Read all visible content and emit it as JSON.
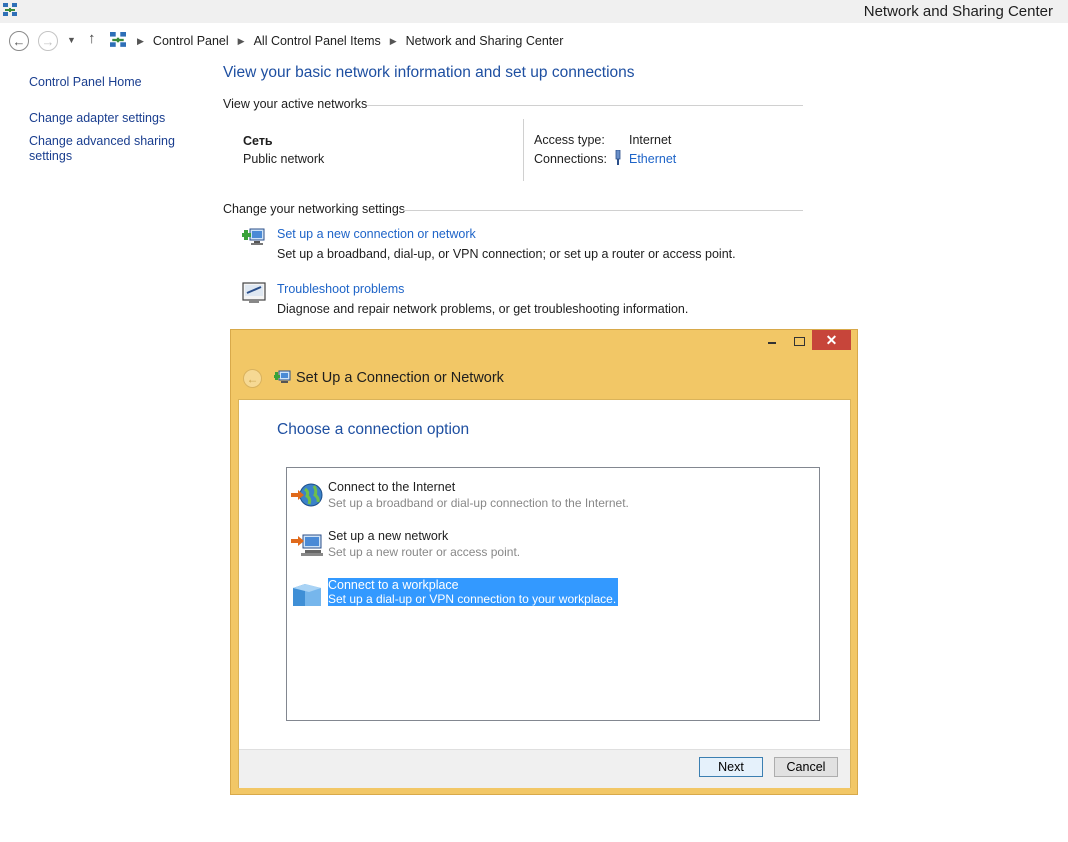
{
  "window": {
    "title": "Network and Sharing Center"
  },
  "address_bar": {
    "crumbs": [
      "Control Panel",
      "All Control Panel Items",
      "Network and Sharing Center"
    ]
  },
  "left_nav": {
    "home": "Control Panel Home",
    "adapter": "Change adapter settings",
    "sharing_line1": "Change advanced sharing",
    "sharing_line2": "settings"
  },
  "main": {
    "heading": "View your basic network information and set up connections",
    "active_networks_label": "View your active networks",
    "network_name": "Сеть",
    "network_type": "Public network",
    "access_type_label": "Access type:",
    "access_type_value": "Internet",
    "connections_label": "Connections:",
    "connections_value": "Ethernet",
    "change_settings_label": "Change your networking settings",
    "setup_link": "Set up a new connection or network",
    "setup_desc": "Set up a broadband, dial-up, or VPN connection; or set up a router or access point.",
    "troubleshoot_link": "Troubleshoot problems",
    "troubleshoot_desc": "Diagnose and repair network problems, or get troubleshooting information."
  },
  "dialog": {
    "title": "Set Up a Connection or Network",
    "heading": "Choose a connection option",
    "options": [
      {
        "title": "Connect to the Internet",
        "subtitle": "Set up a broadband or dial-up connection to the Internet."
      },
      {
        "title": "Set up a new network",
        "subtitle": "Set up a new router or access point."
      },
      {
        "title": "Connect to a workplace",
        "subtitle": "Set up a dial-up or VPN connection to your workplace."
      }
    ],
    "selected_index": 2,
    "next_label": "Next",
    "cancel_label": "Cancel"
  },
  "colors": {
    "dialog_frame": "#f2c766",
    "link": "#1e64c8",
    "heading": "#1e4fa1",
    "selection": "#3399ff",
    "close_button": "#c7453a"
  }
}
